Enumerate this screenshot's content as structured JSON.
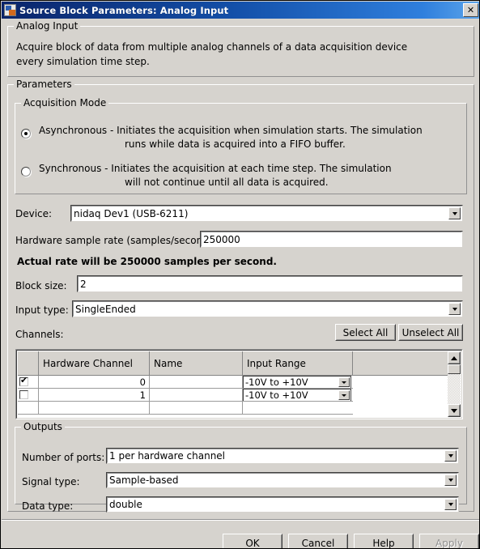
{
  "window": {
    "title": "Source Block Parameters: Analog Input",
    "icon": "simulink-block-icon",
    "close_label": "✕"
  },
  "description_group": {
    "legend": "Analog Input",
    "line1": "Acquire block of data from multiple analog channels of a data acquisition device",
    "line2": "every simulation time step."
  },
  "parameters_group": {
    "legend": "Parameters"
  },
  "acquisition_mode": {
    "legend": "Acquisition Mode",
    "options": [
      {
        "id": "asynchronous",
        "selected": true,
        "line1": "Asynchronous - Initiates the acquisition when simulation starts. The simulation",
        "line2": "runs while data is acquired into a FIFO buffer."
      },
      {
        "id": "synchronous",
        "selected": false,
        "line1": "Synchronous  - Initiates the acquisition at each time step. The simulation",
        "line2": "will not continue until all data is acquired."
      }
    ]
  },
  "device": {
    "label": "Device:",
    "value": "nidaq Dev1 (USB-6211)"
  },
  "sample_rate": {
    "label": "Hardware sample rate (samples/second):",
    "value": "250000"
  },
  "actual_rate_note": "Actual rate will be 250000 samples per second.",
  "block_size": {
    "label": "Block size:",
    "value": "2"
  },
  "input_type": {
    "label": "Input type:",
    "value": "SingleEnded"
  },
  "channels": {
    "label": "Channels:",
    "select_all_label": "Select All",
    "unselect_all_label": "Unselect All",
    "columns": [
      "",
      "Hardware Channel",
      "Name",
      "Input Range",
      ""
    ],
    "rows": [
      {
        "checked": true,
        "hardware_channel": "0",
        "name": "",
        "input_range": "-10V to  +10V"
      },
      {
        "checked": false,
        "hardware_channel": "1",
        "name": "",
        "input_range": "-10V to  +10V"
      }
    ]
  },
  "outputs": {
    "legend": "Outputs",
    "number_of_ports": {
      "label": "Number of ports:",
      "value": "1 per hardware channel"
    },
    "signal_type": {
      "label": "Signal type:",
      "value": "Sample-based"
    },
    "data_type": {
      "label": "Data type:",
      "value": "double"
    }
  },
  "dialog_buttons": {
    "ok": "OK",
    "cancel": "Cancel",
    "help": "Help",
    "apply": "Apply",
    "apply_disabled": true
  },
  "colors": {
    "dialog_face": "#d6d3ce",
    "titlebar_start": "#0a246a",
    "titlebar_end": "#5ba4ea",
    "field_background": "#ffffff",
    "text": "#000000"
  }
}
